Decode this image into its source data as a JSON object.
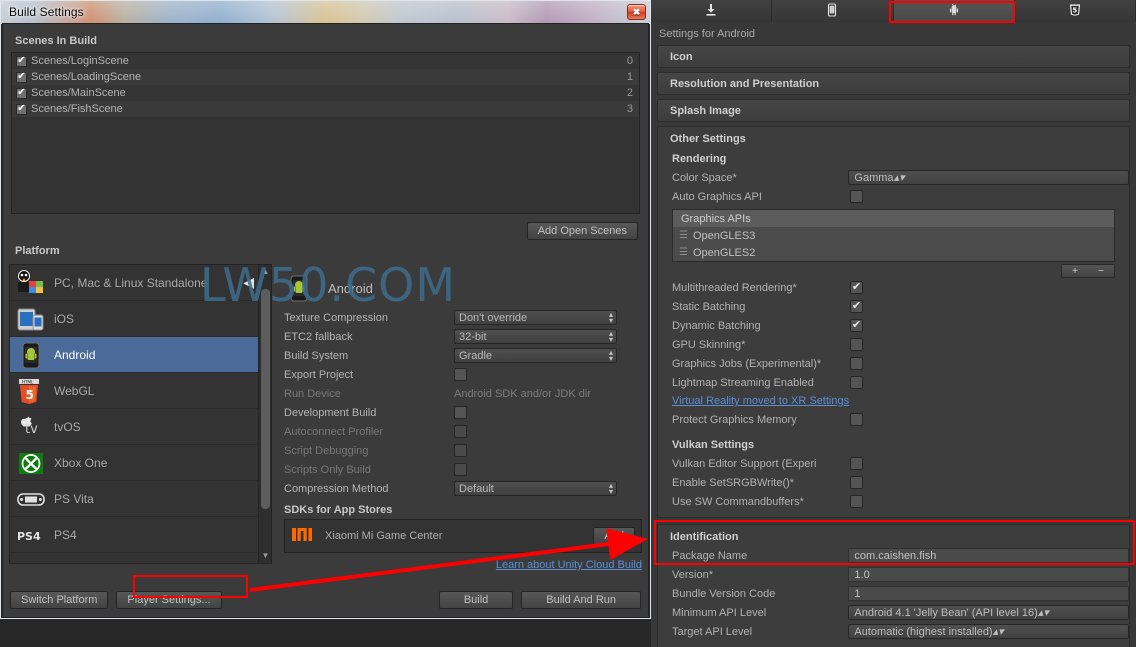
{
  "window": {
    "title": "Build Settings",
    "close_icon": "close-icon"
  },
  "watermark": "LW50.COM",
  "scenes_in_build": {
    "heading": "Scenes In Build",
    "rows": [
      {
        "checked": true,
        "name": "Scenes/LoginScene",
        "index": "0"
      },
      {
        "checked": true,
        "name": "Scenes/LoadingScene",
        "index": "1"
      },
      {
        "checked": true,
        "name": "Scenes/MainScene",
        "index": "2"
      },
      {
        "checked": true,
        "name": "Scenes/FishScene",
        "index": "3"
      }
    ],
    "add_open_scenes_label": "Add Open Scenes"
  },
  "platform": {
    "heading": "Platform",
    "items": [
      {
        "label": "PC, Mac & Linux Standalone",
        "icon": "pc-mac-linux-icon",
        "selected": false,
        "unity_mark": true
      },
      {
        "label": "iOS",
        "icon": "ios-icon",
        "selected": false
      },
      {
        "label": "Android",
        "icon": "android-icon",
        "selected": true
      },
      {
        "label": "WebGL",
        "icon": "html5-icon",
        "selected": false
      },
      {
        "label": "tvOS",
        "icon": "tvos-icon",
        "selected": false
      },
      {
        "label": "Xbox One",
        "icon": "xbox-icon",
        "selected": false
      },
      {
        "label": "PS Vita",
        "icon": "psvita-icon",
        "selected": false
      },
      {
        "label": "PS4",
        "icon": "ps4-icon",
        "selected": false
      },
      {
        "label": "",
        "icon": "windows-icon",
        "selected": false
      }
    ]
  },
  "android_build": {
    "platform_name": "Android",
    "fields": [
      {
        "label": "Texture Compression",
        "type": "popup",
        "value": "Don't override",
        "dim": false
      },
      {
        "label": "ETC2 fallback",
        "type": "popup",
        "value": "32-bit",
        "dim": false
      },
      {
        "label": "Build System",
        "type": "popup",
        "value": "Gradle",
        "dim": false
      },
      {
        "label": "Export Project",
        "type": "checkbox",
        "value": false,
        "dim": false
      },
      {
        "label": "Run Device",
        "type": "text",
        "value": "Android SDK and/or JDK dir",
        "dim": true
      },
      {
        "label": "Development Build",
        "type": "checkbox",
        "value": false,
        "dim": false
      },
      {
        "label": "Autoconnect Profiler",
        "type": "checkbox",
        "value": false,
        "dim": true
      },
      {
        "label": "Script Debugging",
        "type": "checkbox",
        "value": false,
        "dim": true
      },
      {
        "label": "Scripts Only Build",
        "type": "checkbox",
        "value": false,
        "dim": true
      },
      {
        "label": "Compression Method",
        "type": "popup",
        "value": "Default",
        "dim": false
      }
    ],
    "sdks_heading": "SDKs for App Stores",
    "sdk_name": "Xiaomi Mi Game Center",
    "sdk_add_label": "Add",
    "cloud_build_link": "Learn about Unity Cloud Build"
  },
  "bottom_bar": {
    "switch_platform": "Switch Platform",
    "player_settings": "Player Settings...",
    "build": "Build",
    "build_and_run": "Build And Run"
  },
  "inspector": {
    "tabs": [
      {
        "icon": "download-icon",
        "active": false
      },
      {
        "icon": "mobile-icon",
        "active": false
      },
      {
        "icon": "android-icon",
        "active": true
      },
      {
        "icon": "html5-icon",
        "active": false
      }
    ],
    "settings_for": "Settings for Android",
    "foldouts": [
      "Icon",
      "Resolution and Presentation",
      "Splash Image"
    ],
    "other_settings": {
      "title": "Other Settings",
      "rendering": {
        "title": "Rendering",
        "color_space_label": "Color Space*",
        "color_space_value": "Gamma",
        "auto_graphics_api_label": "Auto Graphics API",
        "auto_graphics_api_value": false,
        "graphics_apis_header": "Graphics APIs",
        "graphics_apis": [
          "OpenGLES3",
          "OpenGLES2"
        ],
        "add_label": "+",
        "remove_label": "−",
        "toggles": [
          {
            "label": "Multithreaded Rendering*",
            "value": true
          },
          {
            "label": "Static Batching",
            "value": true
          },
          {
            "label": "Dynamic Batching",
            "value": true
          },
          {
            "label": "GPU Skinning*",
            "value": false
          },
          {
            "label": "Graphics Jobs (Experimental)*",
            "value": false
          },
          {
            "label": "Lightmap Streaming Enabled",
            "value": false
          }
        ],
        "xr_link": "Virtual Reality moved to XR Settings",
        "protect_graphics_memory_label": "Protect Graphics Memory",
        "protect_graphics_memory_value": false
      },
      "vulkan": {
        "title": "Vulkan Settings",
        "toggles": [
          {
            "label": "Vulkan Editor Support (Experi",
            "value": false
          },
          {
            "label": "Enable SetSRGBWrite()*",
            "value": false
          },
          {
            "label": "Use SW Commandbuffers*",
            "value": false
          }
        ]
      }
    },
    "identification": {
      "title": "Identification",
      "rows": [
        {
          "label": "Package Name",
          "type": "field",
          "value": "com.caishen.fish"
        },
        {
          "label": "Version*",
          "type": "field",
          "value": "1.0"
        },
        {
          "label": "Bundle Version Code",
          "type": "field",
          "value": "1"
        },
        {
          "label": "Minimum API Level",
          "type": "popup",
          "value": "Android 4.1 'Jelly Bean' (API level 16)"
        },
        {
          "label": "Target API Level",
          "type": "popup",
          "value": "Automatic (highest installed)"
        }
      ]
    }
  },
  "annotations": {
    "highlight_color": "#ff0000",
    "boxes": [
      "android-tab-highlight",
      "player-settings-highlight",
      "identification-highlight"
    ]
  }
}
